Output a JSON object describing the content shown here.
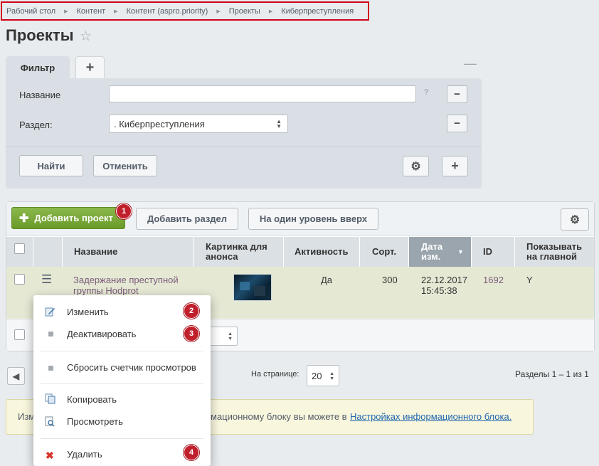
{
  "breadcrumbs": [
    "Рабочий стол",
    "Контент",
    "Контент (aspro.priority)",
    "Проекты",
    "Киберпреступления"
  ],
  "page_title": "Проекты",
  "filter": {
    "tab_label": "Фильтр",
    "add_tab": "+",
    "minimize": "—",
    "name_label": "Название",
    "name_value": "",
    "help": "?",
    "section_label": "Раздел:",
    "section_value": ". Киберпреступления",
    "remove": "−",
    "find_button": "Найти",
    "cancel_button": "Отменить",
    "plus": "+"
  },
  "toolbar": {
    "add_project": "Добавить проект",
    "add_section": "Добавить раздел",
    "level_up": "На один уровень вверх"
  },
  "badges": [
    "1",
    "2",
    "3",
    "4"
  ],
  "table": {
    "headers": [
      "Название",
      "Картинка для анонса",
      "Активность",
      "Сорт.",
      "Дата изм.",
      "ID",
      "Показывать на главной"
    ],
    "sorted_column": "Дата изм.",
    "row": {
      "name": "Задержание преступной группы Hodprot",
      "active": "Да",
      "sort": "300",
      "date": "22.12.2017 15:45:38",
      "id": "1692",
      "show_main": "Y"
    }
  },
  "context_menu": [
    "Изменить",
    "Деактивировать",
    "Сбросить счетчик просмотров",
    "Копировать",
    "Просмотреть",
    "Удалить"
  ],
  "pagination": {
    "per_page_label": "На странице:",
    "per_page_value": "20",
    "summary": "Разделы 1 – 1 из 1"
  },
  "notice": {
    "start": "Изм",
    "middle": "мационному блоку вы можете в ",
    "link": "Настройках информационного блока."
  },
  "colors": {
    "accent_green": "#7aab3a",
    "badge_red": "#c0202c",
    "link": "#2067b0",
    "row_name": "#7a5a7a"
  }
}
